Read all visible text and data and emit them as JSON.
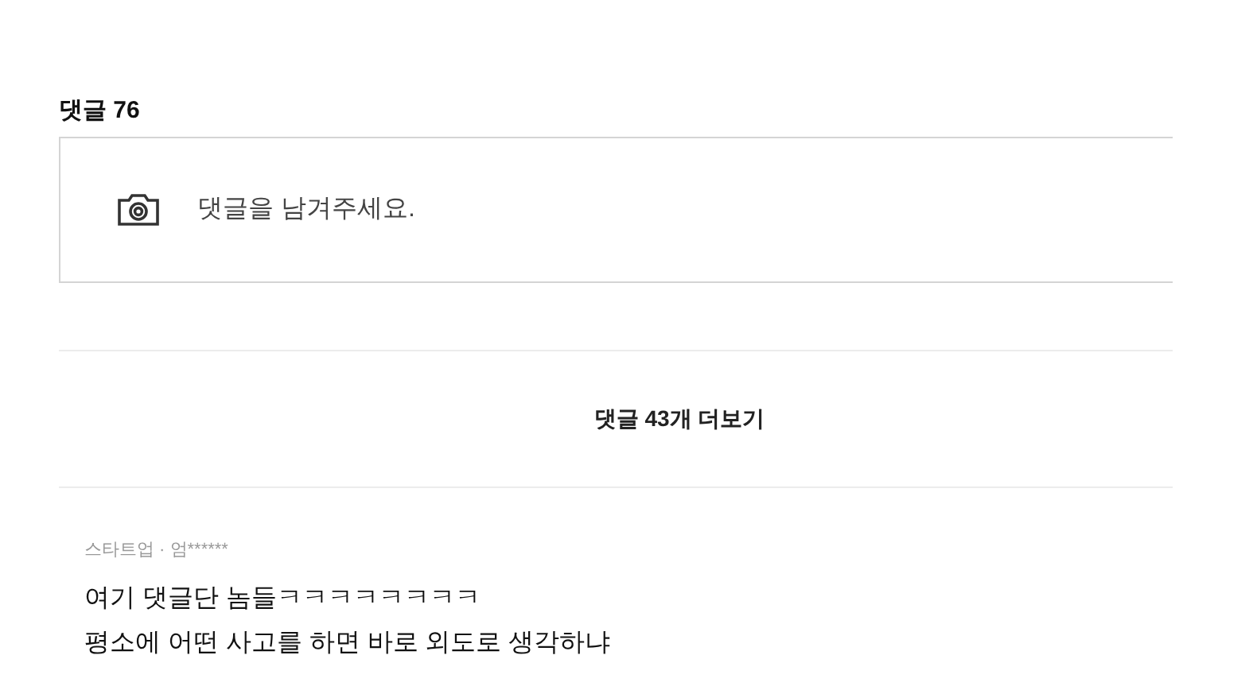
{
  "heading": "댓글 76",
  "comment_input": {
    "placeholder": "댓글을 남겨주세요."
  },
  "more_button": "댓글 43개 더보기",
  "comments": [
    {
      "author": "스타트업 · 엄******",
      "lines": [
        "여기 댓글단 놈들ㅋㅋㅋㅋㅋㅋㅋㅋ",
        "평소에 어떤 사고를 하면 바로 외도로 생각하냐"
      ]
    }
  ]
}
